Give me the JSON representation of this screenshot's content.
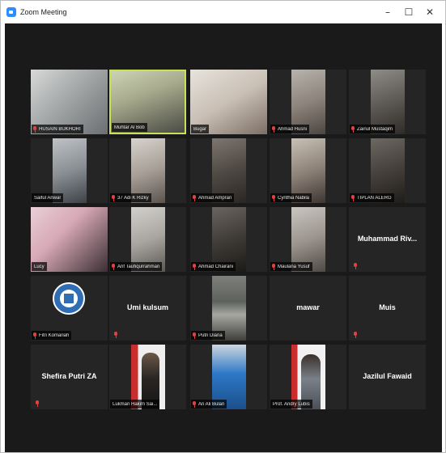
{
  "window": {
    "title": "Zoom Meeting",
    "controls": {
      "minimize": "–",
      "maximize": "☐",
      "close": "✕"
    }
  },
  "participants": [
    {
      "name": "HUSAIN BUKHORI",
      "type": "video"
    },
    {
      "name": "Muhtar Al Bob",
      "type": "video",
      "active": true
    },
    {
      "name": "Bugar",
      "type": "video"
    },
    {
      "name": "Ahmad Husni",
      "type": "video"
    },
    {
      "name": "Zainul Mustaqim",
      "type": "video"
    },
    {
      "name": "Saiful Anwar",
      "type": "video"
    },
    {
      "name": "37 Adi K Rizky",
      "type": "video"
    },
    {
      "name": "Ahmad Ampran",
      "type": "video"
    },
    {
      "name": "Cynthia Nabila",
      "type": "video"
    },
    {
      "name": "TIPLAN ALERG",
      "type": "video"
    },
    {
      "name": "Lucy",
      "type": "video"
    },
    {
      "name": "Arif Taufiqurrahman",
      "type": "video"
    },
    {
      "name": "Ahmad Chairani",
      "type": "video"
    },
    {
      "name": "Maulana Yusuf",
      "type": "video"
    },
    {
      "name": "Muhammad Riv...",
      "type": "text"
    },
    {
      "name": "Fitri Komariah",
      "type": "video"
    },
    {
      "name": "Umi kulsum",
      "type": "text"
    },
    {
      "name": "Putri Diana",
      "type": "video"
    },
    {
      "name": "mawar",
      "type": "text"
    },
    {
      "name": "Muis",
      "type": "text"
    },
    {
      "name": "Shefira Putri ZA",
      "type": "text"
    },
    {
      "name": "Lukman Hakim Sai...",
      "type": "video"
    },
    {
      "name": "Ari Ali Bulan",
      "type": "video"
    },
    {
      "name": "Prof. Andry Lubis",
      "type": "video"
    },
    {
      "name": "Jazilul Fawaid",
      "type": "text"
    }
  ]
}
